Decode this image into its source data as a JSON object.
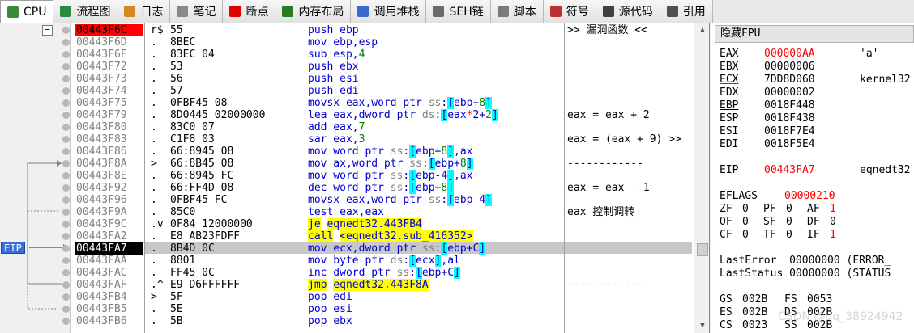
{
  "tabs": [
    {
      "label": "CPU",
      "icon": "cpu-icon",
      "color": "#3a8a3a"
    },
    {
      "label": "流程图",
      "icon": "flowchart-icon",
      "color": "#2a8a40"
    },
    {
      "label": "日志",
      "icon": "log-icon",
      "color": "#d08a20"
    },
    {
      "label": "笔记",
      "icon": "notes-icon",
      "color": "#8a8a8a"
    },
    {
      "label": "断点",
      "icon": "breakpoint-icon",
      "color": "#e00000"
    },
    {
      "label": "内存布局",
      "icon": "memory-map-icon",
      "color": "#2a7a2a"
    },
    {
      "label": "调用堆栈",
      "icon": "call-stack-icon",
      "color": "#3a6ad0"
    },
    {
      "label": "SEH链",
      "icon": "seh-chain-icon",
      "color": "#6a6a6a"
    },
    {
      "label": "脚本",
      "icon": "script-icon",
      "color": "#7a7a7a"
    },
    {
      "label": "符号",
      "icon": "symbols-icon",
      "color": "#c03030"
    },
    {
      "label": "源代码",
      "icon": "source-code-icon",
      "color": "#404040"
    },
    {
      "label": "引用",
      "icon": "references-icon",
      "color": "#505050"
    }
  ],
  "disasm": {
    "eip_label": "EIP",
    "collapse_glyph": "−",
    "rows": [
      {
        "addr": "00443F6C",
        "mk": "r$",
        "bytes": "55",
        "asm": "push ebp",
        "cmt": ">> 漏洞函数 <<"
      },
      {
        "addr": "00443F6D",
        "mk": ".",
        "bytes": "8BEC",
        "asm": "mov ebp,esp",
        "cmt": ""
      },
      {
        "addr": "00443F6F",
        "mk": ".",
        "bytes": "83EC 04",
        "asm": "sub esp,4",
        "cmt": ""
      },
      {
        "addr": "00443F72",
        "mk": ".",
        "bytes": "53",
        "asm": "push ebx",
        "cmt": ""
      },
      {
        "addr": "00443F73",
        "mk": ".",
        "bytes": "56",
        "asm": "push esi",
        "cmt": ""
      },
      {
        "addr": "00443F74",
        "mk": ".",
        "bytes": "57",
        "asm": "push edi",
        "cmt": ""
      },
      {
        "addr": "00443F75",
        "mk": ".",
        "bytes": "0FBF45 08",
        "asm": "movsx eax,word ptr ss:[ebp+8]",
        "cmt": ""
      },
      {
        "addr": "00443F79",
        "mk": ".",
        "bytes": "8D0445 02000000",
        "asm": "lea eax,dword ptr ds:[eax*2+2]",
        "cmt": "eax = eax + 2"
      },
      {
        "addr": "00443F80",
        "mk": ".",
        "bytes": "83C0 07",
        "asm": "add eax,7",
        "cmt": ""
      },
      {
        "addr": "00443F83",
        "mk": ".",
        "bytes": "C1F8 03",
        "asm": "sar eax,3",
        "cmt": "eax = (eax + 9) >>"
      },
      {
        "addr": "00443F86",
        "mk": ".",
        "bytes": "66:8945 08",
        "asm": "mov word ptr ss:[ebp+8],ax",
        "cmt": ""
      },
      {
        "addr": "00443F8A",
        "mk": ">",
        "bytes": "66:8B45 08",
        "asm": "mov ax,word ptr ss:[ebp+8]",
        "cmt": "------------"
      },
      {
        "addr": "00443F8E",
        "mk": ".",
        "bytes": "66:8945 FC",
        "asm": "mov word ptr ss:[ebp-4],ax",
        "cmt": ""
      },
      {
        "addr": "00443F92",
        "mk": ".",
        "bytes": "66:FF4D 08",
        "asm": "dec word ptr ss:[ebp+8]",
        "cmt": "eax = eax - 1"
      },
      {
        "addr": "00443F96",
        "mk": ".",
        "bytes": "0FBF45 FC",
        "asm": "movsx eax,word ptr ss:[ebp-4]",
        "cmt": ""
      },
      {
        "addr": "00443F9A",
        "mk": ".",
        "bytes": "85C0",
        "asm": "test eax,eax",
        "cmt": "eax 控制调转"
      },
      {
        "addr": "00443F9C",
        "mk": ".v",
        "bytes": "0F84 12000000",
        "asm": "je eqnedt32.443FB4",
        "cmt": ""
      },
      {
        "addr": "00443FA2",
        "mk": ".",
        "bytes": "E8 AB23FDFF",
        "asm": "call <eqnedt32.sub_416352>",
        "cmt": ""
      },
      {
        "addr": "00443FA7",
        "mk": ".",
        "bytes": "8B4D 0C",
        "asm": "mov ecx,dword ptr ss:[ebp+C]",
        "cmt": ""
      },
      {
        "addr": "00443FAA",
        "mk": ".",
        "bytes": "8801",
        "asm": "mov byte ptr ds:[ecx],al",
        "cmt": ""
      },
      {
        "addr": "00443FAC",
        "mk": ".",
        "bytes": "FF45 0C",
        "asm": "inc dword ptr ss:[ebp+C]",
        "cmt": ""
      },
      {
        "addr": "00443FAF",
        "mk": ".^",
        "bytes": "E9 D6FFFFFF",
        "asm": "jmp eqnedt32.443F8A",
        "cmt": "------------"
      },
      {
        "addr": "00443FB4",
        "mk": ">",
        "bytes": "5F",
        "asm": "pop edi",
        "cmt": ""
      },
      {
        "addr": "00443FB5",
        "mk": ".",
        "bytes": "5E",
        "asm": "pop esi",
        "cmt": ""
      },
      {
        "addr": "00443FB6",
        "mk": ".",
        "bytes": "5B",
        "asm": "pop ebx",
        "cmt": ""
      }
    ]
  },
  "registers": {
    "header": "隐藏FPU",
    "lines": [
      {
        "name": "EAX",
        "value": "000000AA",
        "extra": "'a'",
        "modified": true,
        "underline": false
      },
      {
        "name": "EBX",
        "value": "00000006",
        "extra": "",
        "modified": false,
        "underline": false
      },
      {
        "name": "ECX",
        "value": "7DD8D060",
        "extra": "kernel32",
        "modified": false,
        "underline": true
      },
      {
        "name": "EDX",
        "value": "00000002",
        "extra": "",
        "modified": false,
        "underline": false
      },
      {
        "name": "EBP",
        "value": "0018F448",
        "extra": "",
        "modified": false,
        "underline": true
      },
      {
        "name": "ESP",
        "value": "0018F438",
        "extra": "",
        "modified": false,
        "underline": false
      },
      {
        "name": "ESI",
        "value": "0018F7E4",
        "extra": "",
        "modified": false,
        "underline": false
      },
      {
        "name": "EDI",
        "value": "0018F5E4",
        "extra": "",
        "modified": false,
        "underline": false
      },
      {
        "name": "EIP",
        "value": "00443FA7",
        "extra": "eqnedt32",
        "modified": true,
        "underline": false
      }
    ],
    "eflags_label": "EFLAGS",
    "eflags_value": "00000210",
    "flags": [
      [
        "ZF",
        "0",
        "PF",
        "0",
        "AF",
        "1"
      ],
      [
        "OF",
        "0",
        "SF",
        "0",
        "DF",
        "0"
      ],
      [
        "CF",
        "0",
        "TF",
        "0",
        "IF",
        "1"
      ]
    ],
    "last_error": "LastError  00000000 (ERROR_",
    "last_status": "LastStatus 00000000 (STATUS",
    "segs": [
      [
        "GS",
        "002B",
        "FS",
        "0053"
      ],
      [
        "ES",
        "002B",
        "DS",
        "002B"
      ],
      [
        "CS",
        "0023",
        "SS",
        "002B"
      ]
    ]
  },
  "watermark": "CSDN @qq_38924942"
}
